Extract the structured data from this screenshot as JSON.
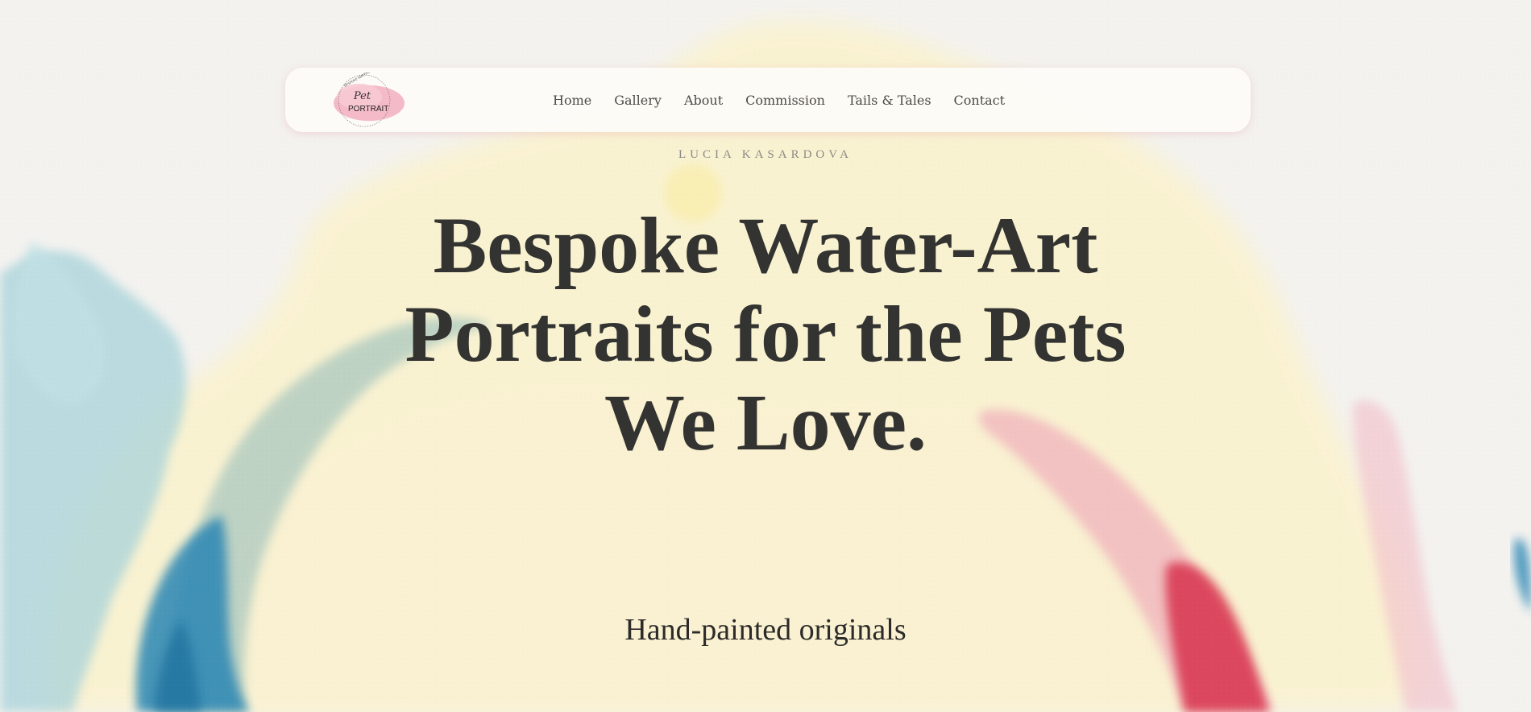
{
  "logo": {
    "small_text": "BESPOKE WATERCOLOUR",
    "title_script": "Pet",
    "title_main": "PORTRAIT"
  },
  "nav": {
    "items": [
      {
        "label": "Home"
      },
      {
        "label": "Gallery"
      },
      {
        "label": "About"
      },
      {
        "label": "Commission"
      },
      {
        "label": "Tails & Tales"
      },
      {
        "label": "Contact"
      }
    ]
  },
  "hero": {
    "artist_name": "LUCIA KASARDOVA",
    "headline_lines": [
      "Bespoke Water-Art",
      "Portraits for the Pets",
      "We Love."
    ],
    "tagline": "Hand-painted originals"
  },
  "colors": {
    "paper": "#f2f1ee",
    "wash_yellow": "#fbf1c8",
    "wash_blue": "#2b86b4",
    "wash_teal": "#a9d2d8",
    "wash_red": "#d8324e",
    "wash_pink": "#f1b9c4",
    "text_dark": "#333331"
  }
}
